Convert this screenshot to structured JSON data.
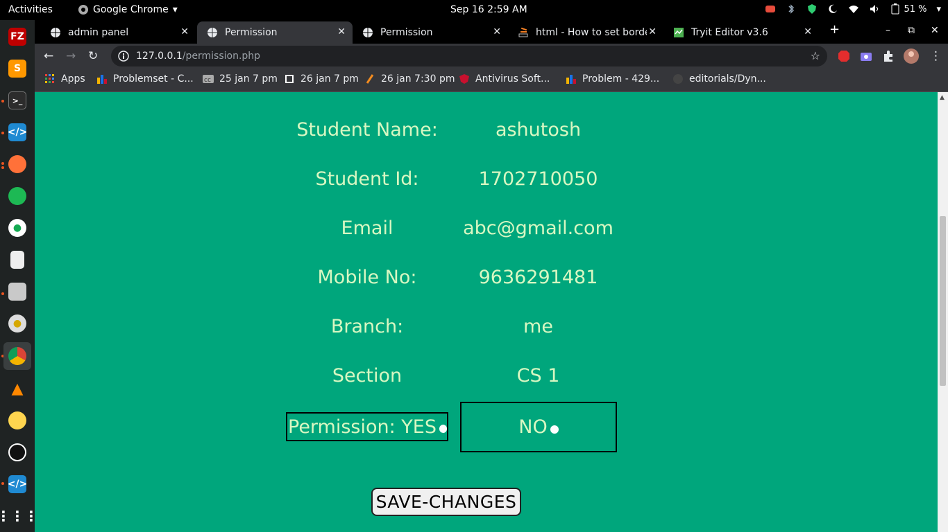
{
  "topbar": {
    "activities": "Activities",
    "app_name": "Google Chrome",
    "clock": "Sep 16   2:59 AM",
    "battery": "51 %"
  },
  "dock": {
    "apps": [
      "filezilla-icon",
      "sublime-icon",
      "terminal-icon",
      "vscode-icon",
      "firefox-icon",
      "spotify-icon",
      "mongodb-icon",
      "text-editor-icon",
      "files-icon",
      "rhythmbox-icon",
      "chrome-icon",
      "vlc-icon",
      "tea-icon",
      "obs-icon",
      "vscode-icon",
      "app-grid-icon"
    ]
  },
  "tabs": [
    {
      "title": "admin panel",
      "icon": "globe-icon"
    },
    {
      "title": "Permission",
      "icon": "globe-icon"
    },
    {
      "title": "Permission",
      "icon": "globe-icon"
    },
    {
      "title": "html - How to set borde",
      "icon": "stackoverflow-icon"
    },
    {
      "title": "Tryit Editor v3.6",
      "icon": "w3schools-icon"
    }
  ],
  "omnibox": {
    "host": "127.0.0.1",
    "path": "/permission.php"
  },
  "bookmarks": [
    {
      "label": "Apps",
      "color": "#e94235"
    },
    {
      "label": "Problemset - C...",
      "color": "#f4b400"
    },
    {
      "label": "25 jan 7 pm",
      "color": "#aaaaaa"
    },
    {
      "label": "26 jan 7 pm",
      "color": "#ffffff"
    },
    {
      "label": "26 jan 7:30 pm",
      "color": "#f28b1f"
    },
    {
      "label": "Antivirus Soft...",
      "color": "#c8102e"
    },
    {
      "label": "Problem - 429...",
      "color": "#1a73e8"
    },
    {
      "label": "editorials/Dyn...",
      "color": "#444444"
    }
  ],
  "form": {
    "rows": [
      {
        "label": "Student Name:",
        "value": "ashutosh"
      },
      {
        "label": "Student Id:",
        "value": "1702710050"
      },
      {
        "label": "Email",
        "value": "abc@gmail.com"
      },
      {
        "label": "Mobile No:",
        "value": "9636291481"
      },
      {
        "label": "Branch:",
        "value": "me"
      },
      {
        "label": "Section",
        "value": "CS 1"
      }
    ],
    "permission_label": "Permission: YES",
    "no_label": "NO",
    "save_label": "SAVE-CHANGES"
  },
  "colors": {
    "page_bg": "#00a67c",
    "text": "#d8f7c2"
  }
}
